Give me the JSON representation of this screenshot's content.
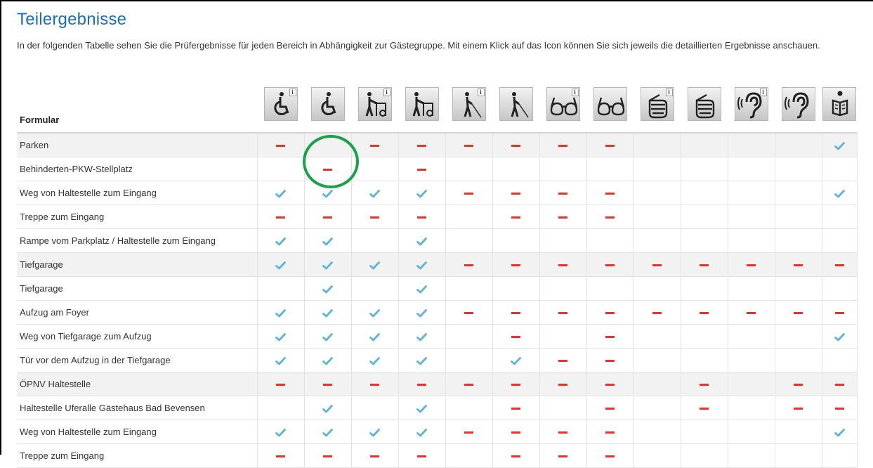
{
  "page": {
    "title": "Teilergebnisse",
    "intro": "In der folgenden Tabelle sehen Sie die Prüfergebnisse für jeden Bereich in Abhängigkeit zur Gästegruppe. Mit einem Klick auf das Icon können Sie sich jeweils die detaillierten Ergebnisse anschauen."
  },
  "colors": {
    "title": "#1a6fb0",
    "check": "#5bb3d8",
    "dash": "#e8322a",
    "highlight": "#1aa14a"
  },
  "table": {
    "header_label": "Formular",
    "columns": [
      {
        "icon": "wheelchair-icon",
        "info": true
      },
      {
        "icon": "wheelchair-icon",
        "info": false
      },
      {
        "icon": "walker-icon",
        "info": true
      },
      {
        "icon": "walker-icon",
        "info": false
      },
      {
        "icon": "blind-cane-icon",
        "info": true
      },
      {
        "icon": "blind-cane-icon",
        "info": false
      },
      {
        "icon": "glasses-icon",
        "info": true
      },
      {
        "icon": "glasses-icon",
        "info": false
      },
      {
        "icon": "sign-language-icon",
        "info": true
      },
      {
        "icon": "sign-language-icon",
        "info": false
      },
      {
        "icon": "ear-icon",
        "info": true
      },
      {
        "icon": "ear-icon",
        "info": false
      },
      {
        "icon": "reading-person-icon",
        "info": false
      }
    ],
    "rows": [
      {
        "label": "Parken",
        "shaded": true,
        "cells": [
          "x",
          "",
          "x",
          "x",
          "x",
          "x",
          "x",
          "x",
          "",
          "",
          "",
          "",
          "v"
        ]
      },
      {
        "label": "Behinderten-PKW-Stellplatz",
        "shaded": false,
        "cells": [
          "",
          "x",
          "",
          "x",
          "",
          "",
          "",
          "",
          "",
          "",
          "",
          "",
          ""
        ]
      },
      {
        "label": "Weg von Haltestelle zum Eingang",
        "shaded": false,
        "cells": [
          "v",
          "v",
          "v",
          "v",
          "x",
          "x",
          "x",
          "x",
          "",
          "",
          "",
          "",
          "v"
        ]
      },
      {
        "label": "Treppe zum Eingang",
        "shaded": false,
        "cells": [
          "x",
          "x",
          "x",
          "x",
          "",
          "x",
          "x",
          "x",
          "",
          "",
          "",
          "",
          ""
        ]
      },
      {
        "label": "Rampe vom Parkplatz / Haltestelle zum Eingang",
        "shaded": false,
        "cells": [
          "v",
          "v",
          "",
          "v",
          "",
          "",
          "",
          "",
          "",
          "",
          "",
          "",
          ""
        ]
      },
      {
        "label": "Tiefgarage",
        "shaded": true,
        "cells": [
          "v",
          "v",
          "v",
          "v",
          "x",
          "x",
          "x",
          "x",
          "x",
          "x",
          "x",
          "x",
          "x"
        ]
      },
      {
        "label": "Tiefgarage",
        "shaded": false,
        "cells": [
          "",
          "v",
          "",
          "v",
          "",
          "",
          "",
          "",
          "",
          "",
          "",
          "",
          ""
        ]
      },
      {
        "label": "Aufzug am Foyer",
        "shaded": false,
        "cells": [
          "v",
          "v",
          "v",
          "v",
          "x",
          "x",
          "x",
          "x",
          "x",
          "x",
          "x",
          "x",
          "x"
        ]
      },
      {
        "label": "Weg von Tiefgarage zum Aufzug",
        "shaded": false,
        "cells": [
          "v",
          "v",
          "v",
          "v",
          "",
          "x",
          "",
          "x",
          "",
          "",
          "",
          "",
          "v"
        ]
      },
      {
        "label": "Tür vor dem Aufzug in der Tiefgarage",
        "shaded": false,
        "cells": [
          "v",
          "v",
          "v",
          "v",
          "",
          "v",
          "x",
          "x",
          "",
          "",
          "",
          "",
          ""
        ]
      },
      {
        "label": "ÖPNV Haltestelle",
        "shaded": true,
        "cells": [
          "x",
          "x",
          "x",
          "x",
          "x",
          "x",
          "x",
          "x",
          "",
          "x",
          "",
          "x",
          "x"
        ]
      },
      {
        "label": "Haltestelle Uferalle Gästehaus Bad Bevensen",
        "shaded": false,
        "cells": [
          "",
          "v",
          "",
          "v",
          "",
          "x",
          "",
          "x",
          "",
          "x",
          "",
          "x",
          "x"
        ]
      },
      {
        "label": "Weg von Haltestelle zum Eingang",
        "shaded": false,
        "cells": [
          "v",
          "v",
          "v",
          "v",
          "x",
          "x",
          "x",
          "x",
          "",
          "",
          "",
          "",
          "v"
        ]
      },
      {
        "label": "Treppe zum Eingang",
        "shaded": false,
        "cells": [
          "x",
          "x",
          "x",
          "x",
          "",
          "x",
          "x",
          "x",
          "",
          "",
          "",
          "",
          ""
        ]
      }
    ]
  }
}
